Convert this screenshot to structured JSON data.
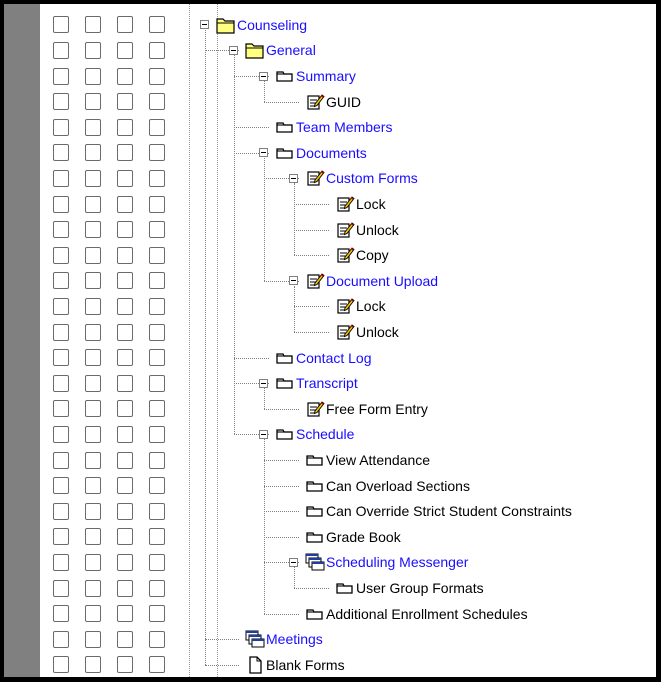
{
  "tree": {
    "nodes": [
      {
        "label": "Counseling",
        "icon": "folder-open-icon",
        "link": true
      },
      {
        "label": "General",
        "icon": "folder-open-icon",
        "link": true
      },
      {
        "label": "Summary",
        "icon": "tab-icon",
        "link": true
      },
      {
        "label": "GUID",
        "icon": "edit-icon",
        "link": false
      },
      {
        "label": "Team Members",
        "icon": "tab-icon",
        "link": true
      },
      {
        "label": "Documents",
        "icon": "tab-icon",
        "link": true
      },
      {
        "label": "Custom Forms",
        "icon": "edit-icon",
        "link": true
      },
      {
        "label": "Lock",
        "icon": "edit-icon",
        "link": false
      },
      {
        "label": "Unlock",
        "icon": "edit-icon",
        "link": false
      },
      {
        "label": "Copy",
        "icon": "edit-icon",
        "link": false
      },
      {
        "label": "Document Upload",
        "icon": "edit-icon",
        "link": true
      },
      {
        "label": "Lock",
        "icon": "edit-icon",
        "link": false
      },
      {
        "label": "Unlock",
        "icon": "edit-icon",
        "link": false
      },
      {
        "label": "Contact Log",
        "icon": "tab-icon",
        "link": true
      },
      {
        "label": "Transcript",
        "icon": "tab-icon",
        "link": true
      },
      {
        "label": "Free Form Entry",
        "icon": "edit-icon",
        "link": false
      },
      {
        "label": "Schedule",
        "icon": "tab-icon",
        "link": true
      },
      {
        "label": "View Attendance",
        "icon": "tab-icon",
        "link": false
      },
      {
        "label": "Can Overload Sections",
        "icon": "tab-icon",
        "link": false
      },
      {
        "label": "Can Override Strict Student Constraints",
        "icon": "tab-icon",
        "link": false
      },
      {
        "label": "Grade Book",
        "icon": "tab-icon",
        "link": false
      },
      {
        "label": "Scheduling Messenger",
        "icon": "windows-icon",
        "link": true
      },
      {
        "label": "User Group Formats",
        "icon": "tab-icon",
        "link": false
      },
      {
        "label": "Additional Enrollment Schedules",
        "icon": "tab-icon",
        "link": false
      },
      {
        "label": "Meetings",
        "icon": "windows-icon",
        "link": true
      },
      {
        "label": "Blank Forms",
        "icon": "document-icon",
        "link": false
      }
    ]
  },
  "colors": {
    "link": "#1a0dff",
    "folder": "#ffff80",
    "gutter": "#808080"
  }
}
